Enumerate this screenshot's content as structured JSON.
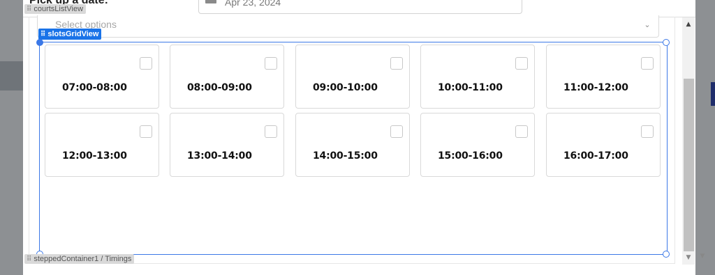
{
  "form": {
    "pick_label": "Pick up a date:",
    "date_value": "Apr 23, 2024",
    "select_placeholder": "Select options"
  },
  "editor_tags": {
    "courts_list": "courtsListView",
    "slots_grid": "slotsGridView",
    "stepped_container": "steppedContainer1 / Timings"
  },
  "slots": [
    {
      "label": "07:00-08:00",
      "checked": false
    },
    {
      "label": "08:00-09:00",
      "checked": false
    },
    {
      "label": "09:00-10:00",
      "checked": false
    },
    {
      "label": "10:00-11:00",
      "checked": false
    },
    {
      "label": "11:00-12:00",
      "checked": false
    },
    {
      "label": "12:00-13:00",
      "checked": false
    },
    {
      "label": "13:00-14:00",
      "checked": false
    },
    {
      "label": "14:00-15:00",
      "checked": false
    },
    {
      "label": "15:00-16:00",
      "checked": false
    },
    {
      "label": "16:00-17:00",
      "checked": false
    }
  ],
  "colors": {
    "selection_blue": "#1a73e8",
    "modal_bg": "#ffffff",
    "overlay": "#8d9093"
  },
  "icons": {
    "calendar": "calendar-icon",
    "chevron": "chevron-down-icon",
    "grip": "drag-grip-icon"
  }
}
